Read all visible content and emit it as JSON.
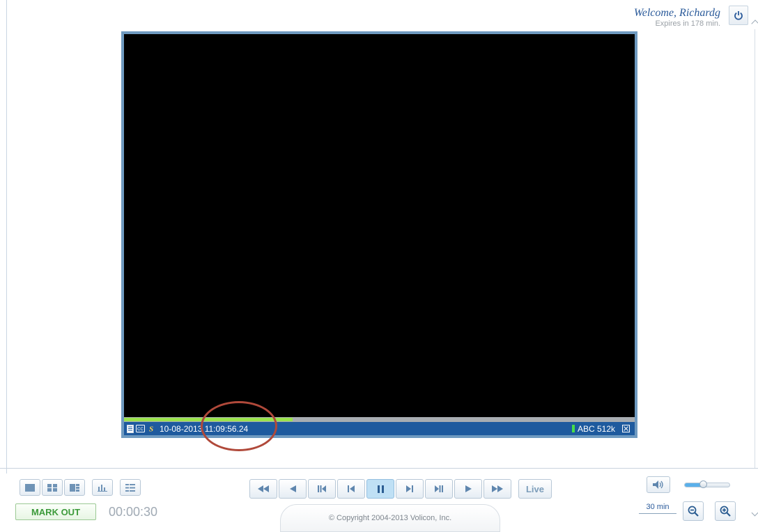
{
  "user": {
    "welcome": "Welcome, Richardg",
    "expires": "Expires in 178 min."
  },
  "player": {
    "timestamp": "10-08-2013 11:09:56.24",
    "channel": "ABC 512k",
    "progress_fraction": 0.33
  },
  "layout_buttons": [
    "single-view",
    "quad-view",
    "split-view",
    "chart-view",
    "list-view"
  ],
  "mark_out": {
    "label": "MARK OUT",
    "duration": "00:00:30"
  },
  "transport": {
    "buttons": [
      "rewind-fast",
      "rewind",
      "prev-segment",
      "prev-frame",
      "pause",
      "next-frame",
      "next-segment",
      "play",
      "fast-forward"
    ],
    "live_label": "Live",
    "active": "pause"
  },
  "volume": {
    "level": 0.4
  },
  "zoom": {
    "label": "30 min"
  },
  "footer": {
    "copyright": "© Copyright 2004-2013 Volicon, Inc."
  },
  "colors": {
    "accent": "#1e5a9e",
    "progress": "#9be34d",
    "mark_out": "#3c9a3a",
    "annotation": "#b0493a"
  }
}
